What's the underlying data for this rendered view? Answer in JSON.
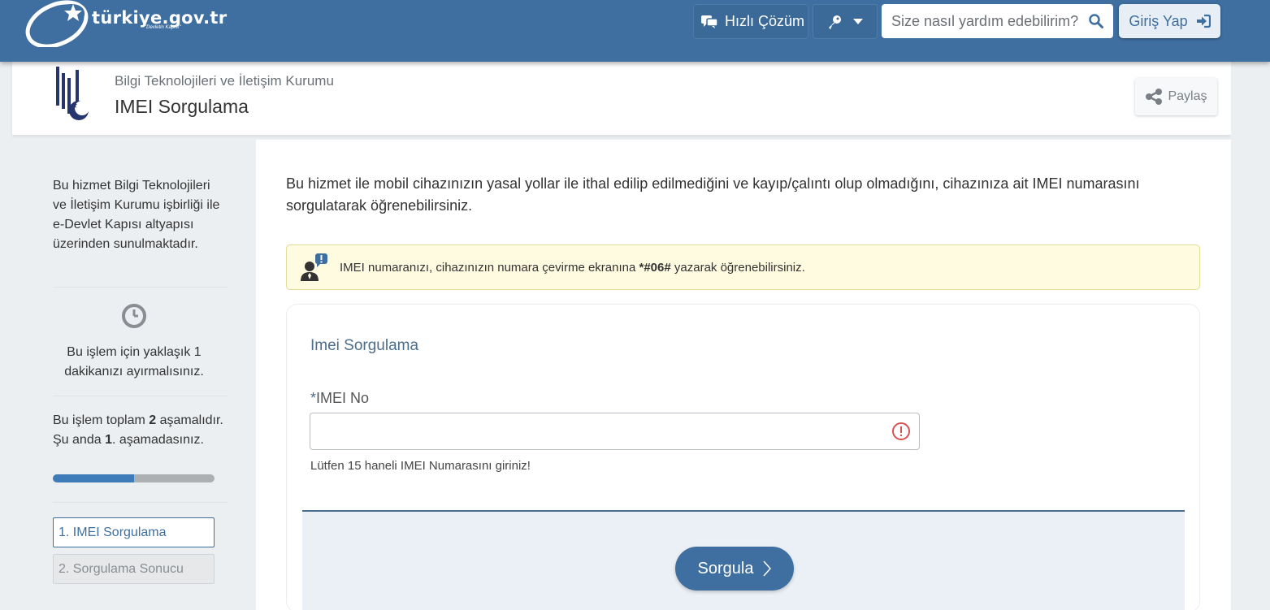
{
  "topbar": {
    "logo_text": "türkiye.gov.tr",
    "logo_sub": "\"Devletin Kapısı\"",
    "quick_label": "Hızlı Çözüm",
    "search_placeholder": "Size nasıl yardım edebilirim?",
    "login_label": "Giriş Yap"
  },
  "header": {
    "institution": "Bilgi Teknolojileri ve İletişim Kurumu",
    "title": "IMEI Sorgulama",
    "share_label": "Paylaş"
  },
  "sidebar": {
    "info": "Bu hizmet Bilgi Teknolojileri ve İletişim Kurumu işbirliği ile e-Devlet Kapısı altyapısı üzerinden sunulmaktadır.",
    "duration": "Bu işlem için yaklaşık 1 dakikanızı ayırmalısınız.",
    "steps_text_a": "Bu işlem toplam ",
    "steps_total": "2",
    "steps_text_b": " aşamalıdır. Şu anda ",
    "steps_current": "1",
    "steps_text_c": ". aşamadasınız.",
    "progress": 0.5,
    "steps": [
      {
        "label": "1. IMEI Sorgulama"
      },
      {
        "label": "2. Sorgulama Sonucu"
      }
    ]
  },
  "main": {
    "intro": "Bu hizmet ile mobil cihazınızın yasal yollar ile ithal edilip edilmediğini ve kayıp/çalıntı olup olmadığını, cihazınıza ait IMEI numarasını sorgulatarak öğrenebilirsiniz.",
    "alert_a": "IMEI numaranızı, cihazınızın numara çevirme ekranına ",
    "alert_code": "*#06#",
    "alert_b": " yazarak öğrenebilirsiniz.",
    "card_title": "Imei Sorgulama",
    "field_required_mark": "*",
    "field_label": "IMEI No",
    "field_value": "",
    "hint": "Lütfen 15 haneli IMEI Numarasını giriniz!",
    "submit_label": "Sorgula"
  },
  "colors": {
    "brand": "#3e6fa0",
    "alert_bg": "#fffbe0",
    "error": "#d9534f"
  }
}
